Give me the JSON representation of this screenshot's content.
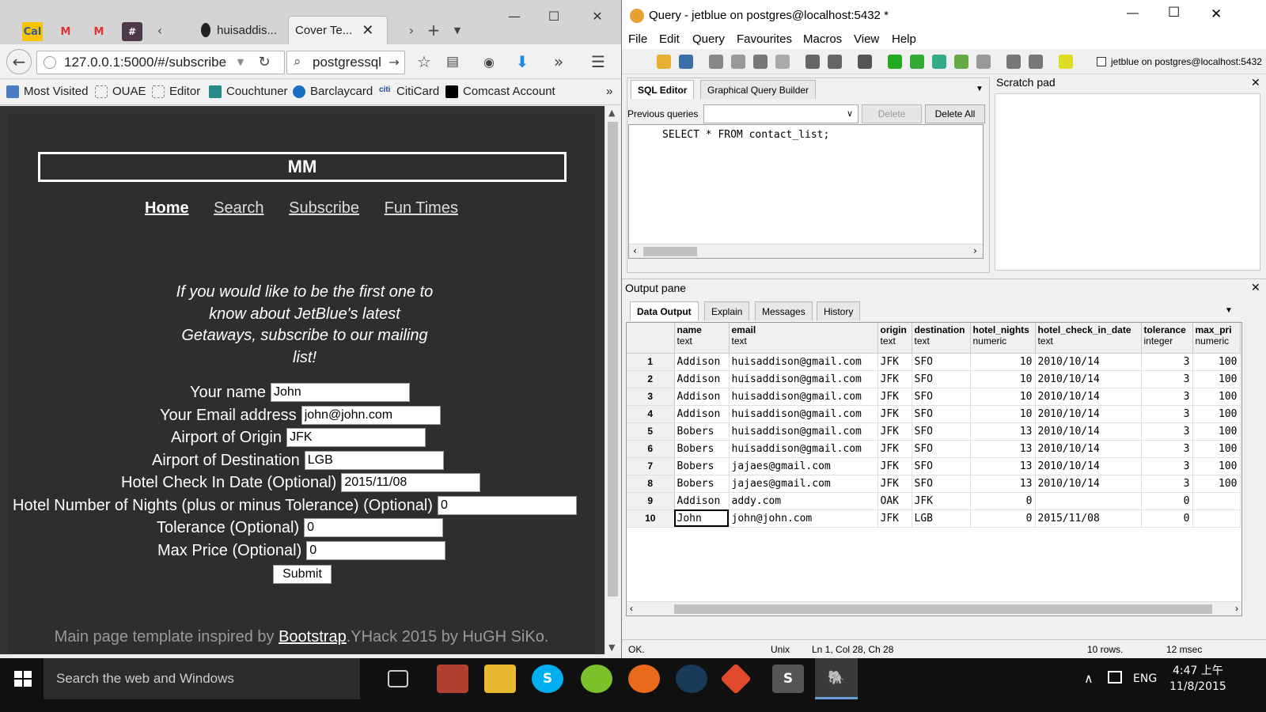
{
  "firefox": {
    "pinned_tabs": [
      "cal-icon",
      "gmail-icon",
      "gmail-icon",
      "slack-icon"
    ],
    "tabs": [
      {
        "label": "huisaddis...",
        "icon": "github-icon"
      },
      {
        "label": "Cover Te...",
        "icon": "page-icon"
      }
    ],
    "url": "127.0.0.1:5000/#/subscribe",
    "search_value": "postgressql",
    "bookmarks": [
      "Most Visited",
      "OUAE",
      "Editor",
      "Couchtuner",
      "Barclaycard",
      "CitiCard",
      "Comcast Account"
    ]
  },
  "page": {
    "brand": "MM",
    "nav": [
      "Home",
      "Search",
      "Subscribe",
      "Fun Times"
    ],
    "lead": "If you would like to be the first one to know about JetBlue's latest Getaways, subscribe to our mailing list!",
    "form": [
      {
        "label": "Your name",
        "value": "John"
      },
      {
        "label": "Your Email address",
        "value": "john@john.com"
      },
      {
        "label": "Airport of Origin",
        "value": "JFK"
      },
      {
        "label": "Airport of Destination",
        "value": "LGB"
      },
      {
        "label": "Hotel Check In Date (Optional)",
        "value": "2015/11/08"
      },
      {
        "label": "Hotel Number of Nights (plus or minus Tolerance) (Optional)",
        "value": "0"
      },
      {
        "label": "Tolerance (Optional)",
        "value": "0"
      },
      {
        "label": "Max Price (Optional)",
        "value": "0"
      }
    ],
    "submit": "Submit",
    "footer_pre": "Main page template inspired by ",
    "footer_link": "Bootstrap",
    "footer_post": ".YHack 2015 by HuGH SiKo."
  },
  "pgadmin": {
    "title": "Query - jetblue on postgres@localhost:5432 *",
    "menu": [
      "File",
      "Edit",
      "Query",
      "Favourites",
      "Macros",
      "View",
      "Help"
    ],
    "connection": "jetblue on postgres@localhost:5432",
    "editor_tabs": [
      "SQL Editor",
      "Graphical Query Builder"
    ],
    "previous_queries_label": "Previous queries",
    "delete_label": "Delete",
    "delete_all_label": "Delete All",
    "sql": "SELECT * FROM contact_list;",
    "scratch_title": "Scratch pad",
    "output_title": "Output pane",
    "output_tabs": [
      "Data Output",
      "Explain",
      "Messages",
      "History"
    ],
    "columns": [
      {
        "name": "name",
        "type": "text"
      },
      {
        "name": "email",
        "type": "text"
      },
      {
        "name": "origin",
        "type": "text"
      },
      {
        "name": "destination",
        "type": "text"
      },
      {
        "name": "hotel_nights",
        "type": "numeric"
      },
      {
        "name": "hotel_check_in_date",
        "type": "text"
      },
      {
        "name": "tolerance",
        "type": "integer"
      },
      {
        "name": "max_pri",
        "type": "numeric"
      }
    ],
    "rows": [
      [
        "1",
        "Addison",
        "huisaddison@gmail.com",
        "JFK",
        "SFO",
        "10",
        "2010/10/14",
        "3",
        "100"
      ],
      [
        "2",
        "Addison",
        "huisaddison@gmail.com",
        "JFK",
        "SFO",
        "10",
        "2010/10/14",
        "3",
        "100"
      ],
      [
        "3",
        "Addison",
        "huisaddison@gmail.com",
        "JFK",
        "SFO",
        "10",
        "2010/10/14",
        "3",
        "100"
      ],
      [
        "4",
        "Addison",
        "huisaddison@gmail.com",
        "JFK",
        "SFO",
        "10",
        "2010/10/14",
        "3",
        "100"
      ],
      [
        "5",
        "Bobers",
        "huisaddison@gmail.com",
        "JFK",
        "SFO",
        "13",
        "2010/10/14",
        "3",
        "100"
      ],
      [
        "6",
        "Bobers",
        "huisaddison@gmail.com",
        "JFK",
        "SFO",
        "13",
        "2010/10/14",
        "3",
        "100"
      ],
      [
        "7",
        "Bobers",
        "jajaes@gmail.com",
        "JFK",
        "SFO",
        "13",
        "2010/10/14",
        "3",
        "100"
      ],
      [
        "8",
        "Bobers",
        "jajaes@gmail.com",
        "JFK",
        "SFO",
        "13",
        "2010/10/14",
        "3",
        "100"
      ],
      [
        "9",
        "Addison",
        "addy.com",
        "OAK",
        "JFK",
        "0",
        "",
        "0",
        ""
      ],
      [
        "10",
        "John",
        "john@john.com",
        "JFK",
        "LGB",
        "0",
        "2015/11/08",
        "0",
        ""
      ]
    ],
    "status": {
      "state": "OK.",
      "eol": "Unix",
      "pos": "Ln 1, Col 28, Ch 28",
      "rows": "10 rows.",
      "time": "12 msec"
    }
  },
  "taskbar": {
    "search_placeholder": "Search the web and Windows",
    "lang": "ENG",
    "time": "4:47 上午",
    "date": "11/8/2015"
  }
}
